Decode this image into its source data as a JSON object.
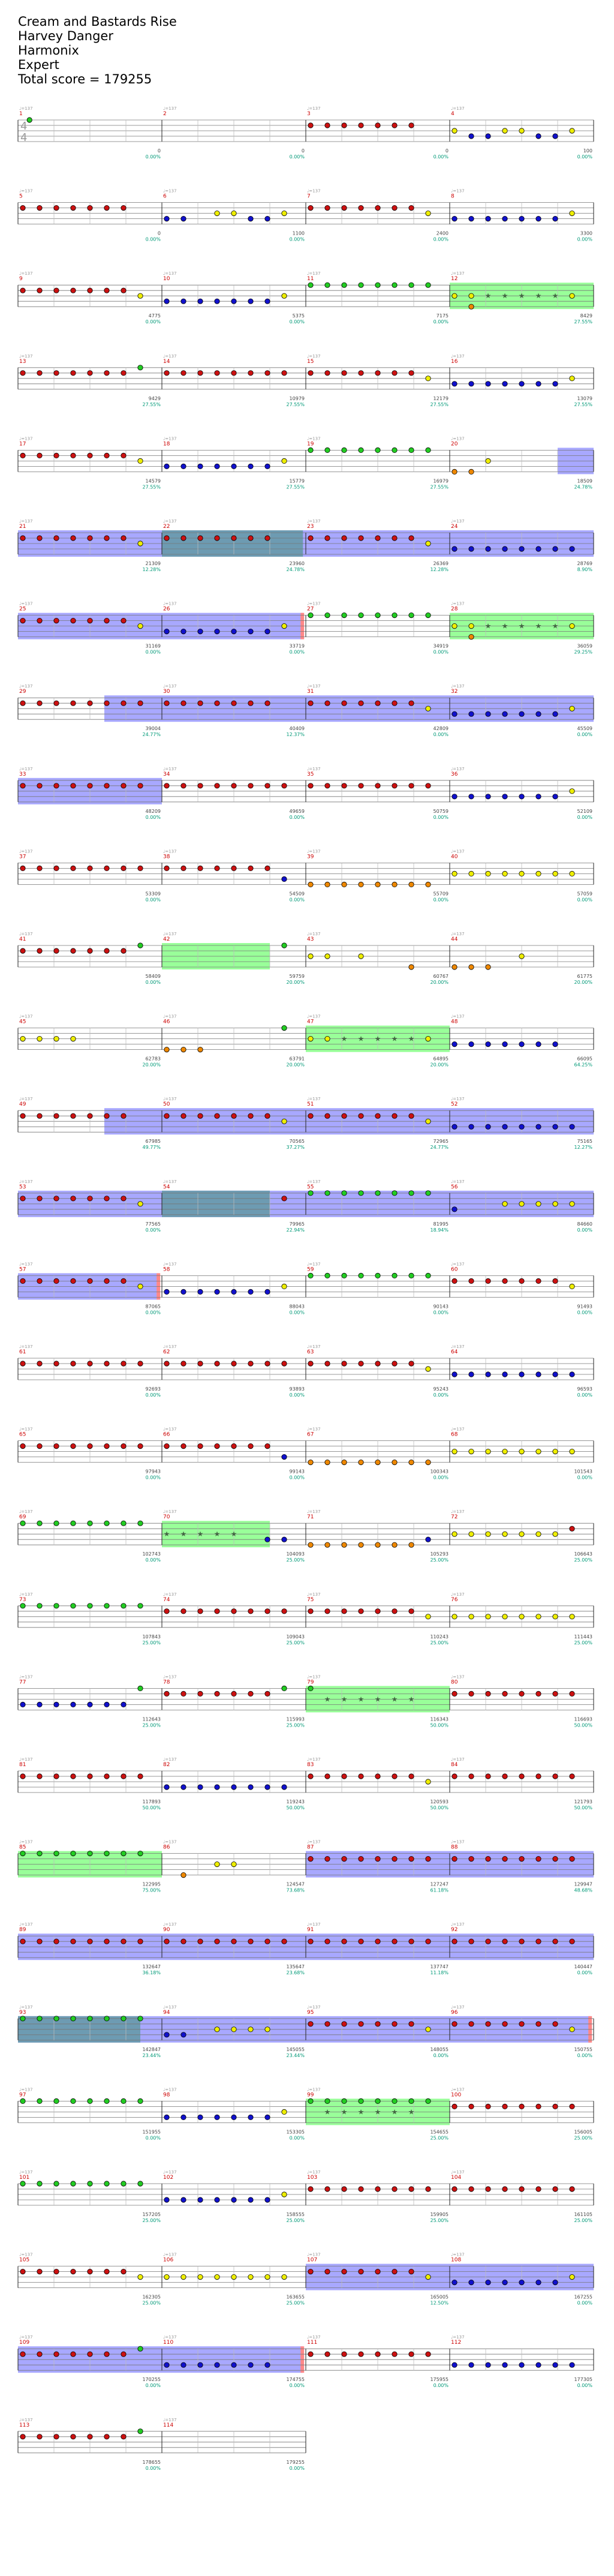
{
  "song": {
    "title": "Cream and Bastards Rise",
    "artist": "Harvey Danger",
    "game": "Harmonix",
    "difficulty": "Expert",
    "total_score": "Total score = 179255"
  },
  "time_signature": {
    "top": "4",
    "bottom": "4"
  },
  "tempo_label": "♩=137",
  "colors": {
    "green": "#22cc22",
    "red": "#cc1111",
    "yellow": "#eeee00",
    "blue": "#1111cc",
    "orange": "#ee8800",
    "sp_phrase": "#99ff99",
    "sp_active": "#9999ff",
    "sp_overlap": "#6699aa",
    "measure_num": "#cc0000",
    "score": "#444444",
    "percent": "#009977",
    "tempo": "#999999",
    "rim": "#ff8888"
  },
  "measures": [
    {
      "n": "1",
      "s": "0",
      "p": "0.00%",
      "notes": "g:0.05"
    },
    {
      "n": "2",
      "s": "0",
      "p": "0.00%",
      "notes": ""
    },
    {
      "n": "3",
      "s": "0",
      "p": "0.00%",
      "notes": "r:0,0.125,0.25,0.375,0.5,0.625,0.75"
    },
    {
      "n": "4",
      "s": "100",
      "s2": "575",
      "p": "0.00%",
      "p2": "0.00%",
      "notes": "y:0,0.375,0.5,0.875 b:0.125,0.25,0.625,0.75"
    },
    {
      "n": "5",
      "s": "0",
      "p": "0.00%",
      "notes": "r:0,0.125,0.25,0.375,0.5,0.625,0.75"
    },
    {
      "n": "6",
      "s": "1100",
      "s2": "1775",
      "p": "0.00%",
      "p2": "0.00%",
      "notes": "b:0,0.125,0.625,0.75 y:0.375,0.5,0.875"
    },
    {
      "n": "7",
      "s": "2400",
      "s2": "3000",
      "p": "0.00%",
      "p2": "0.00%",
      "notes": "r:0,0.125,0.25,0.375,0.5,0.625,0.75 y:0.875"
    },
    {
      "n": "8",
      "s": "3300",
      "p": "0.00%",
      "notes": "b:0,0.125,0.25,0.375,0.5,0.625,0.75 y:0.875"
    },
    {
      "n": "9",
      "s": "4775",
      "p": "0.00%",
      "notes": "r:0,0.125,0.25,0.375,0.5,0.625,0.75 y:0.875"
    },
    {
      "n": "10",
      "s": "5375",
      "p": "0.00%",
      "notes": "b:0,0.125,0.25,0.375,0.5,0.625,0.75 y:0.875"
    },
    {
      "n": "11",
      "s": "7175",
      "p": "0.00%",
      "notes": "g:0,0.125,0.25,0.375,0.5,0.625,0.75,0.875"
    },
    {
      "n": "12",
      "s": "8429",
      "p": "27.55%",
      "notes": "y:0,0.125,0.875 o:0.125",
      "sp": "phrase",
      "stars": "0.25,0.375,0.5,0.625,0.75"
    },
    {
      "n": "13",
      "s": "9429",
      "p": "27.55%",
      "notes": "r:0,0.125,0.25,0.375,0.5,0.625,0.75 g:0.875"
    },
    {
      "n": "14",
      "s": "10979",
      "p": "27.55%",
      "notes": "r:0,0.125,0.25,0.375,0.5,0.625,0.75,0.875"
    },
    {
      "n": "15",
      "s": "12179",
      "p": "27.55%",
      "notes": "r:0,0.125,0.25,0.375,0.5,0.625,0.75 y:0.875"
    },
    {
      "n": "16",
      "s": "13079",
      "p": "27.55%",
      "notes": "b:0,0.125,0.25,0.375,0.5,0.625,0.75 y:0.875"
    },
    {
      "n": "17",
      "s": "14579",
      "p": "27.55%",
      "notes": "r:0,0.125,0.25,0.375,0.5,0.625,0.75 y:0.875"
    },
    {
      "n": "18",
      "s": "15779",
      "p": "27.55%",
      "notes": "b:0,0.125,0.25,0.375,0.5,0.625,0.75 y:0.875"
    },
    {
      "n": "19",
      "s": "16979",
      "p": "27.55%",
      "notes": "g:0,0.125,0.25,0.375,0.5,0.625,0.75,0.875"
    },
    {
      "n": "20",
      "s": "18509",
      "p": "24.78%",
      "notes": "o:0,0.125 y:0.25",
      "sp": "active",
      "sp_start": 0.75
    },
    {
      "n": "21",
      "s": "21309",
      "p": "12.28%",
      "notes": "r:0,0.125,0.25,0.375,0.5,0.625,0.75 y:0.875",
      "sp": "active"
    },
    {
      "n": "22",
      "s": "23960",
      "p": "24.78%",
      "notes": "r:0,0.125,0.25,0.375,0.5,0.625,0.75",
      "sp": "overlap_half"
    },
    {
      "n": "23",
      "s": "26369",
      "p": "12.28%",
      "notes": "r:0,0.125,0.25,0.375,0.5,0.625,0.75 y:0.875",
      "sp": "active"
    },
    {
      "n": "24",
      "s": "28769",
      "p": "8.90%",
      "notes": "b:0,0.125,0.25,0.375,0.5,0.625,0.75,0.875",
      "sp": "active"
    },
    {
      "n": "25",
      "s": "31169",
      "p": "0.00%",
      "notes": "r:0,0.125,0.25,0.375,0.5,0.625,0.75 y:0.875",
      "sp": "active"
    },
    {
      "n": "26",
      "s": "33719",
      "p": "0.00%",
      "notes": "b:0,0.125,0.25,0.375,0.5,0.625,0.75 y:0.875",
      "sp": "active_end"
    },
    {
      "n": "27",
      "s": "34919",
      "p": "0.00%",
      "notes": "g:0,0.125,0.25,0.375,0.5,0.625,0.75,0.875"
    },
    {
      "n": "28",
      "s": "36059",
      "p": "29.25%",
      "notes": "y:0,0.125,0.875 o:0.125",
      "sp": "phrase",
      "stars": "0.25,0.375,0.5,0.625,0.75"
    },
    {
      "n": "29",
      "s": "39004",
      "p": "24.77%",
      "notes": "r:0,0.125,0.25,0.375,0.5,0.625,0.75,0.875",
      "sp": "active_start"
    },
    {
      "n": "30",
      "s": "40409",
      "p": "12.37%",
      "notes": "r:0,0.125,0.25,0.375,0.5,0.625,0.75",
      "sp": "active"
    },
    {
      "n": "31",
      "s": "42809",
      "p": "0.00%",
      "notes": "r:0,0.125,0.25,0.375,0.5,0.625,0.75 y:0.875",
      "sp": "active"
    },
    {
      "n": "32",
      "s": "45509",
      "p": "0.00%",
      "notes": "b:0,0.125,0.25,0.375,0.5,0.625,0.75 y:0.875",
      "sp": "active"
    },
    {
      "n": "33",
      "s": "48209",
      "p": "0.00%",
      "notes": "r:0,0.125,0.25,0.375,0.5,0.625,0.75,0.875",
      "sp": "active"
    },
    {
      "n": "34",
      "s": "49659",
      "p": "0.00%",
      "notes": "r:0,0.125,0.25,0.375,0.5,0.625,0.75,0.875"
    },
    {
      "n": "35",
      "s": "50759",
      "p": "0.00%",
      "notes": "r:0,0.125,0.25,0.375,0.5,0.625,0.75,0.875"
    },
    {
      "n": "36",
      "s": "52109",
      "p": "0.00%",
      "notes": "b:0,0.125,0.25,0.375,0.5,0.625,0.75 y:0.875"
    },
    {
      "n": "37",
      "s": "53309",
      "p": "0.00%",
      "notes": "r:0,0.125,0.25,0.375,0.5,0.625,0.75,0.875"
    },
    {
      "n": "38",
      "s": "54509",
      "p": "0.00%",
      "notes": "r:0,0.125,0.25,0.375,0.5,0.625,0.75 b:0.875"
    },
    {
      "n": "39",
      "s": "55709",
      "p": "0.00%",
      "notes": "o:0,0.125,0.25,0.375,0.5,0.625,0.75,0.875"
    },
    {
      "n": "40",
      "s": "57059",
      "p": "0.00%",
      "notes": "y:0,0.125,0.25,0.375,0.5,0.625,0.75,0.875"
    },
    {
      "n": "41",
      "s": "58409",
      "p": "0.00%",
      "notes": "r:0,0.125,0.25,0.375,0.5,0.625,0.75 g:0.875"
    },
    {
      "n": "42",
      "s": "59759",
      "p": "20.00%",
      "notes": "g:0.875",
      "sp": "phrase_partial",
      "stars": ""
    },
    {
      "n": "43",
      "s": "60767",
      "p": "20.00%",
      "notes": "y:0,0.125,0.375 o:0.75"
    },
    {
      "n": "44",
      "s": "61775",
      "p": "20.00%",
      "notes": "o:0,0.125,0.25 y:0.5"
    },
    {
      "n": "45",
      "s": "62783",
      "p": "20.00%",
      "notes": "y:0,0.125,0.25,0.375"
    },
    {
      "n": "46",
      "s": "63791",
      "p": "20.00%",
      "notes": "o:0,0.125,0.25 g:0.875"
    },
    {
      "n": "47",
      "s": "64895",
      "p": "20.00%",
      "notes": "y:0,0.125,0.875",
      "sp": "phrase",
      "stars": "0.25,0.375,0.5,0.625,0.75"
    },
    {
      "n": "48",
      "s": "66095",
      "p": "64.25%",
      "notes": "b:0,0.125,0.25,0.375,0.5,0.625,0.75"
    },
    {
      "n": "49",
      "s": "67985",
      "p": "49.77%",
      "notes": "r:0,0.125,0.25,0.375,0.5,0.625,0.75",
      "sp": "active_start"
    },
    {
      "n": "50",
      "s": "70565",
      "p": "37.27%",
      "notes": "r:0,0.125,0.25,0.375,0.5,0.625,0.75 y:0.875",
      "sp": "active"
    },
    {
      "n": "51",
      "s": "72965",
      "p": "24.77%",
      "notes": "r:0,0.125,0.25,0.375,0.5,0.625,0.75 y:0.875",
      "sp": "active"
    },
    {
      "n": "52",
      "s": "75165",
      "p": "12.27%",
      "notes": "b:0,0.125,0.25,0.375,0.5,0.625,0.75,0.875",
      "sp": "active"
    },
    {
      "n": "53",
      "s": "77565",
      "p": "0.00%",
      "notes": "r:0,0.125,0.25,0.375,0.5,0.625,0.75 y:0.875",
      "sp": "active"
    },
    {
      "n": "54",
      "s": "79965",
      "p": "22.94%",
      "notes": "r:0.875",
      "sp": "overlap"
    },
    {
      "n": "55",
      "s": "81995",
      "p": "18.94%",
      "notes": "g:0,0.125,0.25,0.375,0.5,0.625,0.75,0.875",
      "sp": "active"
    },
    {
      "n": "56",
      "s": "84660",
      "p": "0.00%",
      "notes": "y:0.375,0.5,0.625,0.75,0.875 b:0",
      "sp": "active"
    },
    {
      "n": "57",
      "s": "87065",
      "p": "0.00%",
      "notes": "r:0,0.125,0.25,0.375,0.5,0.625,0.75 y:0.875",
      "sp": "active_end"
    },
    {
      "n": "58",
      "s": "88043",
      "p": "0.00%",
      "notes": "b:0,0.125,0.25,0.375,0.5,0.625,0.75 y:0.875"
    },
    {
      "n": "59",
      "s": "90143",
      "p": "0.00%",
      "notes": "g:0,0.125,0.25,0.375,0.5,0.625,0.75,0.875"
    },
    {
      "n": "60",
      "s": "91493",
      "p": "0.00%",
      "notes": "r:0,0.125,0.25,0.375,0.5,0.625,0.75 y:0.875"
    },
    {
      "n": "61",
      "s": "92693",
      "p": "0.00%",
      "notes": "r:0,0.125,0.25,0.375,0.5,0.625,0.75,0.875"
    },
    {
      "n": "62",
      "s": "93893",
      "p": "0.00%",
      "notes": "r:0,0.125,0.25,0.375,0.5,0.625,0.75,0.875"
    },
    {
      "n": "63",
      "s": "95243",
      "p": "0.00%",
      "notes": "r:0,0.125,0.25,0.375,0.5,0.625,0.75 y:0.875"
    },
    {
      "n": "64",
      "s": "96593",
      "p": "0.00%",
      "notes": "b:0,0.125,0.25,0.375,0.5,0.625,0.75,0.875"
    },
    {
      "n": "65",
      "s": "97943",
      "p": "0.00%",
      "notes": "r:0,0.125,0.25,0.375,0.5,0.625,0.75,0.875"
    },
    {
      "n": "66",
      "s": "99143",
      "p": "0.00%",
      "notes": "r:0,0.125,0.25,0.375,0.5,0.625,0.75 b:0.875"
    },
    {
      "n": "67",
      "s": "100343",
      "p": "0.00%",
      "notes": "o:0,0.125,0.25,0.375,0.5,0.625,0.75,0.875"
    },
    {
      "n": "68",
      "s": "101543",
      "p": "0.00%",
      "notes": "y:0,0.125,0.25,0.375,0.5,0.625,0.75,0.875"
    },
    {
      "n": "69",
      "s": "102743",
      "p": "0.00%",
      "notes": "g:0,0.125,0.25,0.375,0.5,0.625,0.75,0.875"
    },
    {
      "n": "70",
      "s": "104093",
      "p": "25.00%",
      "notes": "b:0.75,0.875",
      "sp": "phrase_partial",
      "stars": "0,0.125,0.25,0.375,0.5"
    },
    {
      "n": "71",
      "s": "105293",
      "p": "25.00%",
      "notes": "o:0,0.125,0.25,0.375,0.5,0.625,0.75 b:0.875"
    },
    {
      "n": "72",
      "s": "106643",
      "p": "25.00%",
      "notes": "y:0,0.125,0.25,0.375,0.5,0.625,0.75 r:0.875"
    },
    {
      "n": "73",
      "s": "107843",
      "p": "25.00%",
      "notes": "g:0,0.125,0.25,0.375,0.5,0.625,0.75,0.875"
    },
    {
      "n": "74",
      "s": "109043",
      "p": "25.00%",
      "notes": "r:0,0.125,0.25,0.375,0.5,0.625,0.75,0.875"
    },
    {
      "n": "75",
      "s": "110243",
      "p": "25.00%",
      "notes": "r:0,0.125,0.25,0.375,0.5,0.625,0.75 y:0.875"
    },
    {
      "n": "76",
      "s": "111443",
      "p": "25.00%",
      "notes": "y:0,0.125,0.25,0.375,0.5,0.625,0.75,0.875"
    },
    {
      "n": "77",
      "s": "112643",
      "p": "25.00%",
      "notes": "b:0,0.125,0.25,0.375,0.5,0.625,0.75 g:0.875"
    },
    {
      "n": "78",
      "s": "115993",
      "p": "25.00%",
      "notes": "r:0,0.125,0.25,0.375,0.5,0.625,0.75 g:0.875"
    },
    {
      "n": "79",
      "s": "116343",
      "p": "50.00%",
      "notes": "g:0",
      "sp": "phrase",
      "stars": "0.125,0.25,0.375,0.5,0.625,0.75"
    },
    {
      "n": "80",
      "s": "116693",
      "p": "50.00%",
      "notes": "r:0,0.125,0.25,0.375,0.5,0.625,0.75,0.875"
    },
    {
      "n": "81",
      "s": "117893",
      "p": "50.00%",
      "notes": "r:0,0.125,0.25,0.375,0.5,0.625,0.75,0.875"
    },
    {
      "n": "82",
      "s": "119243",
      "p": "50.00%",
      "notes": "b:0,0.125,0.25,0.375,0.5,0.625,0.75,0.875"
    },
    {
      "n": "83",
      "s": "120593",
      "p": "50.00%",
      "notes": "r:0,0.125,0.25,0.375,0.5,0.625,0.75 y:0.875"
    },
    {
      "n": "84",
      "s": "121793",
      "p": "50.00%",
      "notes": "r:0,0.125,0.25,0.375,0.5,0.625,0.75,0.875"
    },
    {
      "n": "85",
      "s": "122995",
      "p": "75.00%",
      "notes": "g:0,0.125,0.25,0.375,0.5,0.625,0.75,0.875",
      "sp": "phrase",
      "stars": ""
    },
    {
      "n": "86",
      "s": "124547",
      "p": "73.68%",
      "notes": "y:0.375,0.5 o:0.125",
      "sp": "none"
    },
    {
      "n": "87",
      "s": "127247",
      "p": "61.18%",
      "notes": "r:0,0.125,0.25,0.375,0.5,0.625,0.75,0.875",
      "sp": "active"
    },
    {
      "n": "88",
      "s": "129947",
      "p": "48.68%",
      "notes": "r:0,0.125,0.25,0.375,0.5,0.625,0.75,0.875",
      "sp": "active"
    },
    {
      "n": "89",
      "s": "132647",
      "p": "36.18%",
      "notes": "r:0,0.125,0.25,0.375,0.5,0.625,0.75,0.875",
      "sp": "active"
    },
    {
      "n": "90",
      "s": "135647",
      "p": "23.68%",
      "notes": "r:0,0.125,0.25,0.375,0.5,0.625,0.75,0.875",
      "sp": "active"
    },
    {
      "n": "91",
      "s": "137747",
      "p": "11.18%",
      "notes": "r:0,0.125,0.25,0.375,0.5,0.625,0.75,0.875",
      "sp": "active"
    },
    {
      "n": "92",
      "s": "140447",
      "p": "0.00%",
      "notes": "r:0,0.125,0.25,0.375,0.5,0.625,0.75,0.875",
      "sp": "active"
    },
    {
      "n": "93",
      "s": "142847",
      "p": "23.44%",
      "notes": "g:0,0.125,0.25,0.375,0.5,0.625,0.75,0.875",
      "sp": "overlap_part"
    },
    {
      "n": "94",
      "s": "145055",
      "p": "23.44%",
      "notes": "b:0,0.125 y:0.375,0.5,0.625,0.75",
      "sp": "active"
    },
    {
      "n": "95",
      "s": "148055",
      "p": "0.00%",
      "notes": "r:0,0.125,0.25,0.375,0.5,0.625,0.75 y:0.875",
      "sp": "active"
    },
    {
      "n": "96",
      "s": "150755",
      "p": "0.00%",
      "notes": "r:0,0.125,0.25,0.375,0.5,0.625,0.75 y:0.875",
      "sp": "active_end"
    },
    {
      "n": "97",
      "s": "151955",
      "p": "0.00%",
      "notes": "g:0,0.125,0.25,0.375,0.5,0.625,0.75,0.875"
    },
    {
      "n": "98",
      "s": "153305",
      "p": "0.00%",
      "notes": "b:0,0.125,0.25,0.375,0.5,0.625,0.75 y:0.875"
    },
    {
      "n": "99",
      "s": "154655",
      "p": "25.00%",
      "notes": "g:0,0.125,0.25,0.375,0.5,0.625,0.75,0.875",
      "sp": "phrase",
      "stars": "0.125,0.25,0.375,0.5,0.625,0.75"
    },
    {
      "n": "100",
      "s": "156005",
      "p": "25.00%",
      "notes": "r:0,0.125,0.25,0.375,0.5,0.625,0.75,0.875"
    },
    {
      "n": "101",
      "s": "157205",
      "p": "25.00%",
      "notes": "g:0,0.125,0.25,0.375,0.5,0.625,0.75,0.875"
    },
    {
      "n": "102",
      "s": "158555",
      "p": "25.00%",
      "notes": "b:0,0.125,0.25,0.375,0.5,0.625,0.75 y:0.875"
    },
    {
      "n": "103",
      "s": "159905",
      "p": "25.00%",
      "notes": "r:0,0.125,0.25,0.375,0.5,0.625,0.75,0.875"
    },
    {
      "n": "104",
      "s": "161105",
      "p": "25.00%",
      "notes": "r:0,0.125,0.25,0.375,0.5,0.625,0.75,0.875"
    },
    {
      "n": "105",
      "s": "162305",
      "p": "25.00%",
      "notes": "r:0,0.125,0.25,0.375,0.5,0.625,0.75 y:0.875"
    },
    {
      "n": "106",
      "s": "163655",
      "p": "25.00%",
      "notes": "y:0,0.125,0.25,0.375,0.5,0.625,0.75,0.875"
    },
    {
      "n": "107",
      "s": "165005",
      "p": "12.50%",
      "notes": "r:0,0.125,0.25,0.375,0.5,0.625,0.75 y:0.875",
      "sp": "active"
    },
    {
      "n": "108",
      "s": "167255",
      "p": "0.00%",
      "notes": "b:0,0.125,0.25,0.375,0.5,0.625,0.75 y:0.875",
      "sp": "active"
    },
    {
      "n": "109",
      "s": "170255",
      "p": "0.00%",
      "notes": "r:0,0.125,0.25,0.375,0.5,0.625,0.75 g:0.875",
      "sp": "active"
    },
    {
      "n": "110",
      "s": "174755",
      "p": "0.00%",
      "notes": "b:0,0.125,0.25,0.375,0.5,0.625,0.75",
      "sp": "active_end"
    },
    {
      "n": "111",
      "s": "175955",
      "p": "0.00%",
      "notes": "r:0,0.125,0.25,0.375,0.5,0.625,0.75,0.875"
    },
    {
      "n": "112",
      "s": "177305",
      "p": "0.00%",
      "notes": "b:0,0.125,0.25,0.375,0.5,0.625,0.75,0.875"
    },
    {
      "n": "113",
      "s": "178655",
      "p": "0.00%",
      "notes": "r:0,0.125,0.25,0.375,0.5,0.625,0.75 g:0.875"
    },
    {
      "n": "114",
      "s": "179255",
      "p": "0.00%",
      "notes": ""
    }
  ]
}
